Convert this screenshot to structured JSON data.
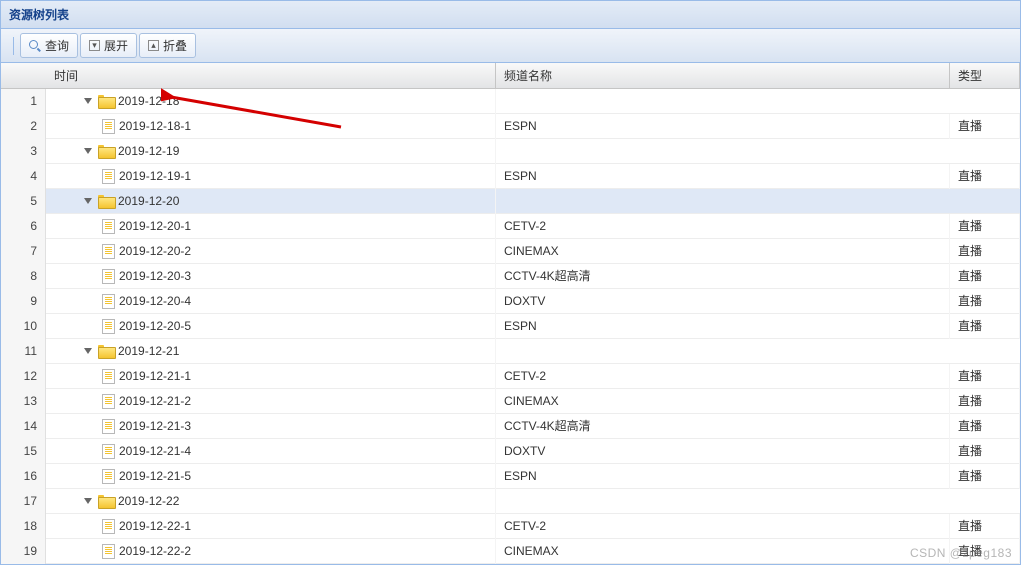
{
  "panel": {
    "title": "资源树列表"
  },
  "toolbar": {
    "query": "查询",
    "expand": "展开",
    "collapse": "折叠"
  },
  "columns": {
    "time": "时间",
    "channel": "频道名称",
    "type": "类型"
  },
  "selected_row": 5,
  "rows": [
    {
      "num": 1,
      "kind": "folder",
      "label": "2019-12-18",
      "channel": "",
      "type": ""
    },
    {
      "num": 2,
      "kind": "file",
      "label": "2019-12-18-1",
      "channel": "ESPN",
      "type": "直播"
    },
    {
      "num": 3,
      "kind": "folder",
      "label": "2019-12-19",
      "channel": "",
      "type": ""
    },
    {
      "num": 4,
      "kind": "file",
      "label": "2019-12-19-1",
      "channel": "ESPN",
      "type": "直播"
    },
    {
      "num": 5,
      "kind": "folder",
      "label": "2019-12-20",
      "channel": "",
      "type": ""
    },
    {
      "num": 6,
      "kind": "file",
      "label": "2019-12-20-1",
      "channel": "CETV-2",
      "type": "直播"
    },
    {
      "num": 7,
      "kind": "file",
      "label": "2019-12-20-2",
      "channel": "CINEMAX",
      "type": "直播"
    },
    {
      "num": 8,
      "kind": "file",
      "label": "2019-12-20-3",
      "channel": "CCTV-4K超高清",
      "type": "直播"
    },
    {
      "num": 9,
      "kind": "file",
      "label": "2019-12-20-4",
      "channel": "DOXTV",
      "type": "直播"
    },
    {
      "num": 10,
      "kind": "file",
      "label": "2019-12-20-5",
      "channel": "ESPN",
      "type": "直播"
    },
    {
      "num": 11,
      "kind": "folder",
      "label": "2019-12-21",
      "channel": "",
      "type": ""
    },
    {
      "num": 12,
      "kind": "file",
      "label": "2019-12-21-1",
      "channel": "CETV-2",
      "type": "直播"
    },
    {
      "num": 13,
      "kind": "file",
      "label": "2019-12-21-2",
      "channel": "CINEMAX",
      "type": "直播"
    },
    {
      "num": 14,
      "kind": "file",
      "label": "2019-12-21-3",
      "channel": "CCTV-4K超高清",
      "type": "直播"
    },
    {
      "num": 15,
      "kind": "file",
      "label": "2019-12-21-4",
      "channel": "DOXTV",
      "type": "直播"
    },
    {
      "num": 16,
      "kind": "file",
      "label": "2019-12-21-5",
      "channel": "ESPN",
      "type": "直播"
    },
    {
      "num": 17,
      "kind": "folder",
      "label": "2019-12-22",
      "channel": "",
      "type": ""
    },
    {
      "num": 18,
      "kind": "file",
      "label": "2019-12-22-1",
      "channel": "CETV-2",
      "type": "直播"
    },
    {
      "num": 19,
      "kind": "file",
      "label": "2019-12-22-2",
      "channel": "CINEMAX",
      "type": "直播"
    }
  ],
  "watermark": "CSDN @zpeg183"
}
